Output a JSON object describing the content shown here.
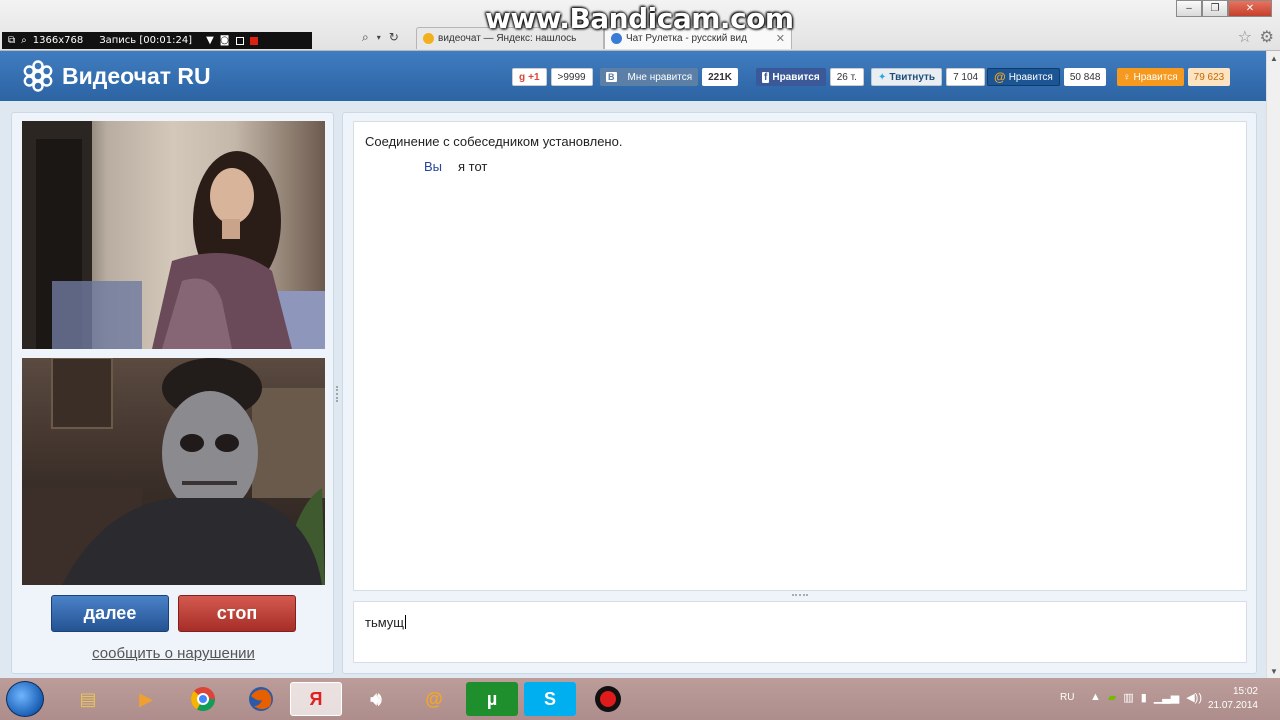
{
  "recorder": {
    "resolution": "1366x768",
    "record_label": "Запись [00:01:24]",
    "watermark": "www.Bandicam.com"
  },
  "browser": {
    "tabs": [
      {
        "title": "видеочат — Яндекс: нашлось"
      },
      {
        "title": "Чат Рулетка - русский вид"
      }
    ]
  },
  "site": {
    "logo_text": "Видеочат RU",
    "social": {
      "gplus": {
        "label": "+1",
        "count": ">9999"
      },
      "vk": {
        "letter": "B",
        "label": "Мне нравится",
        "count": "221K"
      },
      "fb": {
        "letter": "f",
        "label": "Нравится",
        "count": "26 т."
      },
      "tw": {
        "label": "Твитнуть",
        "count": "7 104"
      },
      "mail": {
        "label": "Нравится",
        "count": "50 848"
      },
      "ok": {
        "label": "Нравится",
        "count": "79 623"
      }
    }
  },
  "left": {
    "next_button": "далее",
    "stop_button": "стоп",
    "report_link": "сообщить о нарушении"
  },
  "chat": {
    "system_message": "Соединение с собеседником установлено.",
    "messages": [
      {
        "author": "Вы",
        "text": "я тот"
      }
    ],
    "input_value": "тьмущ"
  },
  "taskbar": {
    "lang": "RU",
    "time": "15:02",
    "date": "21.07.2014"
  }
}
